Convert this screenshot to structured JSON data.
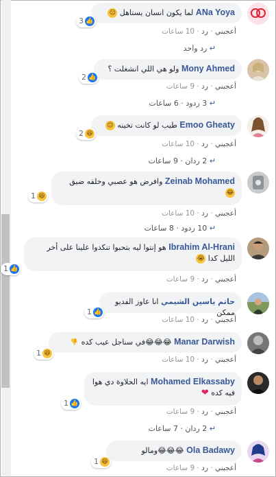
{
  "labels": {
    "like": "أعجبني",
    "reply": "رد",
    "sep": "·"
  },
  "comments": [
    {
      "name": "ANa Yoya",
      "text": "لما يكون انسان يستاهل",
      "emoji": "😑",
      "reaction_count": "3",
      "time": "10 ساعات",
      "replies": "رد واحد"
    },
    {
      "name": "Mony Ahmed",
      "text": "ولو هي اللي انشغلت ؟",
      "reaction_count": "2",
      "time": "9 ساعات",
      "replies": "3 ردود · 6 ساعات"
    },
    {
      "name": "Emoo Gheaty",
      "text": "طيب لو كانت تخينه",
      "emoji": "😉",
      "reaction_count": "2",
      "time": "10 ساعات",
      "replies": "2 ردان · 9 ساعات"
    },
    {
      "name": "Zeinab Mohamed",
      "text": "وافرض هو عصبي وخلقه ضيق",
      "emoji": "😂",
      "reaction_count": "1",
      "time": "10 ساعات",
      "replies": "10 ردود · 8 ساعات"
    },
    {
      "name": "Ibrahim Al-Hrani",
      "text": "هو إنتوا ليه بتحبوا تنكدوا علينا على أخر الليل كدا",
      "emoji": "😭",
      "reaction_count": "1",
      "time": "9 ساعات"
    },
    {
      "name": "حاتم ياسين الشيمي",
      "text": "انا عاوز الفديو ممكن",
      "reaction_count": "1",
      "time": "10 ساعات"
    },
    {
      "name": "Manar Darwish",
      "text": "😂😂😂في سناجل عيب كده",
      "emoji": "👎",
      "reaction_count": "1",
      "time": "10 ساعات"
    },
    {
      "name": "Mohamed Elkassaby",
      "text": "ايه الحلاوة دي هوا فيه كده",
      "emoji": "❤",
      "reaction_count": "1",
      "time": "9 ساعات",
      "replies": "2 ردان · 7 ساعات"
    },
    {
      "name": "Ola Badawy",
      "text": "😂😂😂ومالو",
      "reaction_count": "1",
      "time": "9 ساعات"
    }
  ]
}
